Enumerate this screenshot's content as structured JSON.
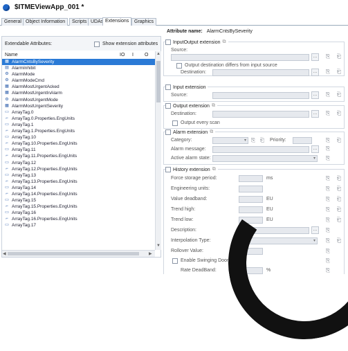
{
  "window": {
    "title": "$ITMEViewApp_001 *"
  },
  "tabs": [
    "General",
    "Object Information",
    "Scripts",
    "UDAs",
    "Extensions",
    "Graphics"
  ],
  "left": {
    "header": "Extendable Attributes:",
    "show_label": "Show extension attributes",
    "columns": {
      "name": "Name",
      "i": "IO",
      "c": "I",
      "o": "O"
    },
    "rows": [
      {
        "label": "AlarmCntsBySeverity",
        "icon": "▦",
        "selected": true
      },
      {
        "label": "AlarmInhibit",
        "icon": "▤"
      },
      {
        "label": "AlarmMode",
        "icon": "⚙"
      },
      {
        "label": "AlarmModeCmd",
        "icon": "⚙"
      },
      {
        "label": "AlarmMostUrgentAcked",
        "icon": "▦"
      },
      {
        "label": "AlarmMostUrgentInAlarm",
        "icon": "▦"
      },
      {
        "label": "AlarmMostUrgentMode",
        "icon": "⚙"
      },
      {
        "label": "AlarmMostUrgentSeverity",
        "icon": "▦"
      },
      {
        "label": "ArrayTag.0",
        "icon": "▭"
      },
      {
        "label": "ArrayTag.0.Properties.EngUnits",
        "icon": "⌐"
      },
      {
        "label": "ArrayTag.1",
        "icon": "▭"
      },
      {
        "label": "ArrayTag.1.Properties.EngUnits",
        "icon": "⌐"
      },
      {
        "label": "ArrayTag.10",
        "icon": "▭"
      },
      {
        "label": "ArrayTag.10.Properties.EngUnits",
        "icon": "⌐"
      },
      {
        "label": "ArrayTag.11",
        "icon": "▭"
      },
      {
        "label": "ArrayTag.11.Properties.EngUnits",
        "icon": "⌐"
      },
      {
        "label": "ArrayTag.12",
        "icon": "▭"
      },
      {
        "label": "ArrayTag.12.Properties.EngUnits",
        "icon": "⌐"
      },
      {
        "label": "ArrayTag.13",
        "icon": "▭"
      },
      {
        "label": "ArrayTag.13.Properties.EngUnits",
        "icon": "⌐"
      },
      {
        "label": "ArrayTag.14",
        "icon": "▭"
      },
      {
        "label": "ArrayTag.14.Properties.EngUnits",
        "icon": "⌐"
      },
      {
        "label": "ArrayTag.15",
        "icon": "▭"
      },
      {
        "label": "ArrayTag.15.Properties.EngUnits",
        "icon": "⌐"
      },
      {
        "label": "ArrayTag.16",
        "icon": "▭"
      },
      {
        "label": "ArrayTag.16.Properties.EngUnits",
        "icon": "⌐"
      },
      {
        "label": "ArrayTag.17",
        "icon": "▭"
      }
    ]
  },
  "right": {
    "attr_name_label": "Attribute name:",
    "attr_name_value": "AlarmCntsBySeverity",
    "io": {
      "title": "InputOutput extension",
      "source": "Source:",
      "differs": "Output destination differs from input source",
      "destination": "Destination:"
    },
    "input": {
      "title": "Input extension",
      "source": "Source:"
    },
    "output": {
      "title": "Output extension",
      "destination": "Destination:",
      "every_scan": "Output every scan"
    },
    "alarm": {
      "title": "Alarm extension",
      "category": "Category:",
      "priority": "Priority:",
      "message": "Alarm message:",
      "active": "Active alarm state:"
    },
    "history": {
      "title": "History extension",
      "force": "Force storage period:",
      "force_unit": "ms",
      "eng": "Engineering units:",
      "deadband": "Value deadband:",
      "deadband_unit": "EU",
      "high": "Trend high:",
      "high_unit": "EU",
      "low": "Trend low:",
      "low_unit": "EU",
      "desc": "Description:",
      "interp": "Interpolation Type:",
      "rollover": "Rollover Value:",
      "swinging": "Enable Swinging Door",
      "rate": "Rate DeadBand:",
      "rate_unit": "%"
    }
  }
}
